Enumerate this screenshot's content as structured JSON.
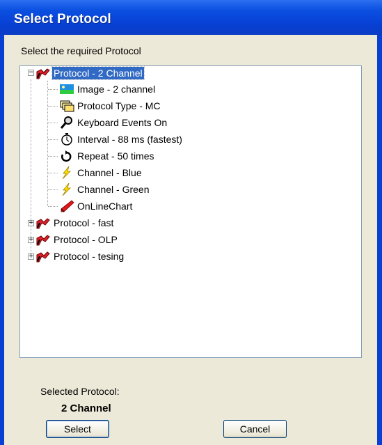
{
  "window": {
    "title": "Select Protocol"
  },
  "prompt": "Select the required Protocol",
  "tree": {
    "root": {
      "label": "Protocol - 2 Channel",
      "expanded": true,
      "selected": true
    },
    "children": [
      {
        "label": "Image - 2 channel",
        "icon": "image-icon"
      },
      {
        "label": "Protocol Type - MC",
        "icon": "stack-icon"
      },
      {
        "label": "Keyboard Events On",
        "icon": "magnifier-icon"
      },
      {
        "label": "Interval - 88 ms (fastest)",
        "icon": "stopwatch-icon"
      },
      {
        "label": "Repeat - 50 times",
        "icon": "repeat-icon"
      },
      {
        "label": "Channel - Blue",
        "icon": "lightning-icon"
      },
      {
        "label": "Channel - Green",
        "icon": "lightning-icon"
      },
      {
        "label": "OnLineChart",
        "icon": "pen-icon"
      }
    ],
    "siblings": [
      {
        "label": "Protocol - fast",
        "expanded": false
      },
      {
        "label": "Protocol - OLP",
        "expanded": false
      },
      {
        "label": "Protocol - tesing",
        "expanded": false
      }
    ]
  },
  "selected_caption": "Selected Protocol:",
  "selected_value": "2 Channel",
  "buttons": {
    "select": "Select",
    "cancel": "Cancel"
  },
  "colors": {
    "title_bar": "#0a4fe0",
    "selection": "#316ac5",
    "dialog_bg": "#ece9d8"
  }
}
